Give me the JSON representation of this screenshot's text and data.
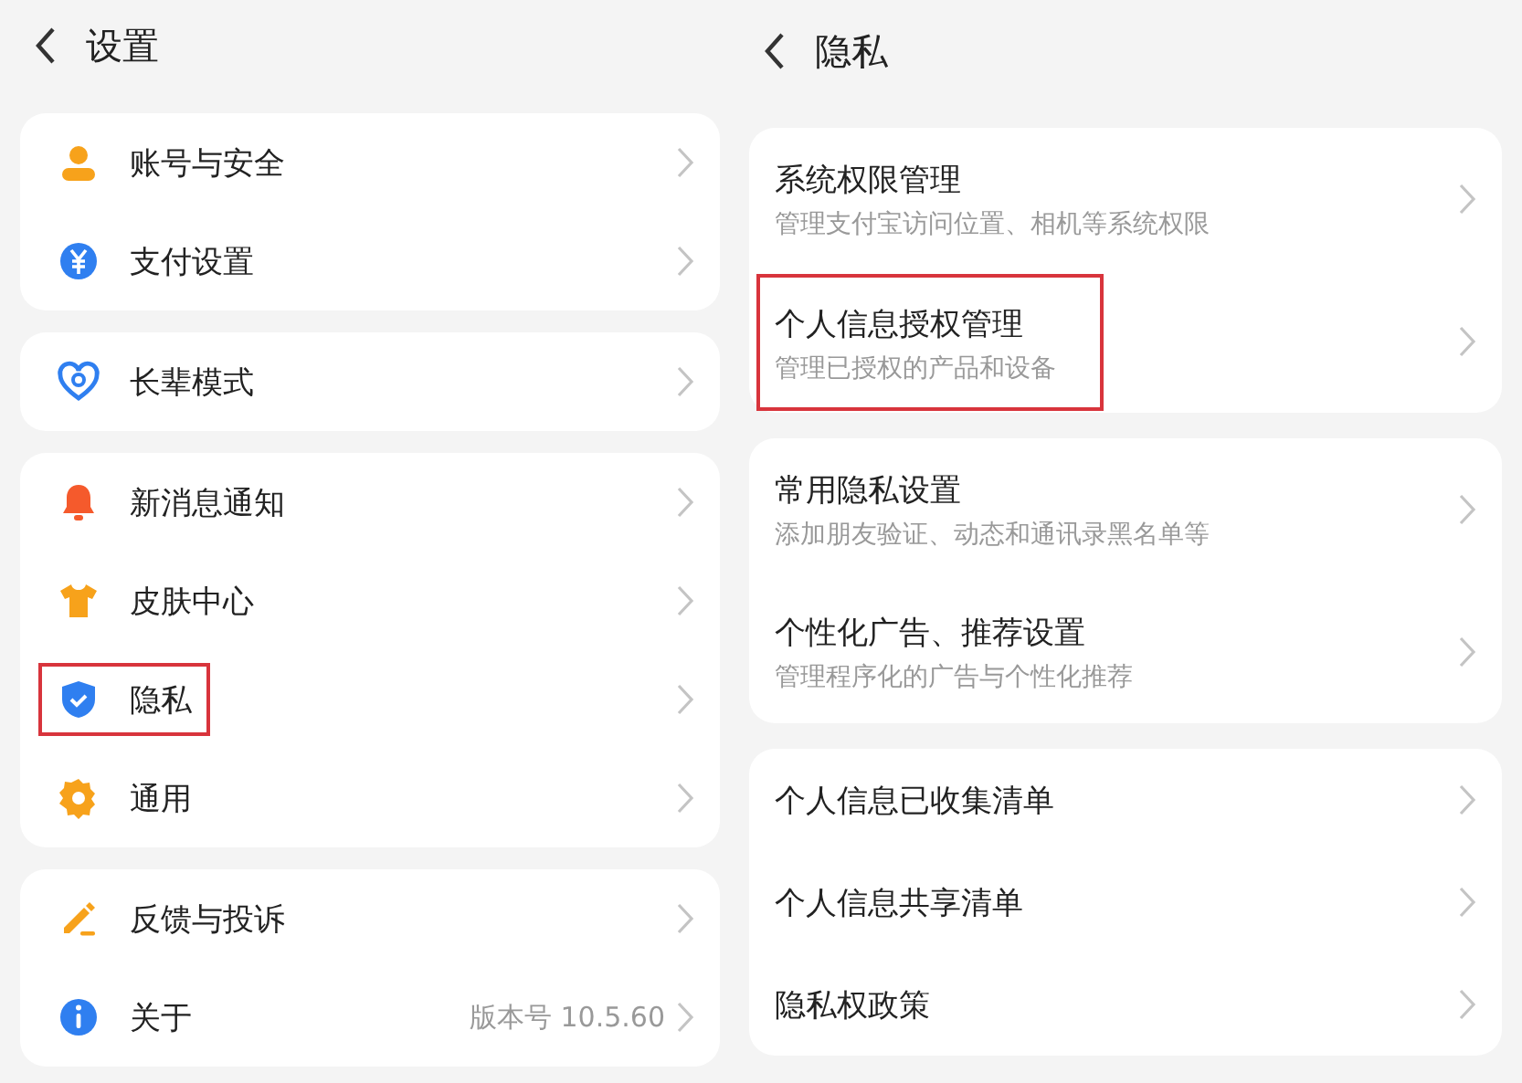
{
  "panels": [
    {
      "title": "设置",
      "groups": [
        {
          "items": [
            {
              "label": "账号与安全",
              "highlighted": false
            },
            {
              "label": "支付设置",
              "highlighted": false
            }
          ]
        },
        {
          "items": [
            {
              "label": "长辈模式",
              "highlighted": false
            }
          ]
        },
        {
          "items": [
            {
              "label": "新消息通知",
              "highlighted": false
            },
            {
              "label": "皮肤中心",
              "highlighted": false
            },
            {
              "label": "隐私",
              "highlighted": true
            },
            {
              "label": "通用",
              "highlighted": false
            }
          ]
        },
        {
          "items": [
            {
              "label": "反馈与投诉",
              "highlighted": false
            },
            {
              "label": "关于",
              "value": "版本号 10.5.60",
              "highlighted": false
            }
          ]
        }
      ]
    },
    {
      "title": "隐私",
      "groups": [
        {
          "items": [
            {
              "label": "系统权限管理",
              "subtitle": "管理支付宝访问位置、相机等系统权限",
              "highlighted": false
            },
            {
              "label": "个人信息授权管理",
              "subtitle": "管理已授权的产品和设备",
              "highlighted": true
            }
          ]
        },
        {
          "items": [
            {
              "label": "常用隐私设置",
              "subtitle": "添加朋友验证、动态和通讯录黑名单等",
              "highlighted": false
            },
            {
              "label": "个性化广告、推荐设置",
              "subtitle": "管理程序化的广告与个性化推荐",
              "highlighted": false
            }
          ]
        },
        {
          "items": [
            {
              "label": "个人信息已收集清单",
              "highlighted": false
            },
            {
              "label": "个人信息共享清单",
              "highlighted": false
            },
            {
              "label": "隐私权政策",
              "highlighted": false
            }
          ]
        }
      ]
    }
  ]
}
